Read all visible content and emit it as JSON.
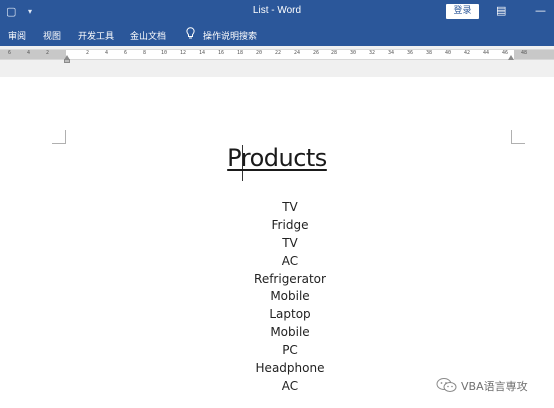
{
  "window": {
    "title": "List  -  Word",
    "login_label": "登录"
  },
  "menu": {
    "items": [
      {
        "label": "审阅"
      },
      {
        "label": "视图"
      },
      {
        "label": "开发工具"
      },
      {
        "label": "金山文档"
      }
    ],
    "tell_me_label": "操作说明搜索"
  },
  "ruler": {
    "left_numbers": [
      "6",
      "4",
      "2"
    ],
    "right_numbers": [
      "2",
      "4",
      "6",
      "8",
      "10",
      "12",
      "14",
      "16",
      "18",
      "20",
      "22",
      "24",
      "26",
      "28",
      "30",
      "32",
      "34",
      "36",
      "38",
      "40",
      "42",
      "44",
      "46",
      "48"
    ]
  },
  "document": {
    "title": "Products",
    "items": [
      "TV",
      "Fridge",
      "TV",
      "AC",
      "Refrigerator",
      "Mobile",
      "Laptop",
      "Mobile",
      "PC",
      "Headphone",
      "AC"
    ]
  },
  "watermark": {
    "text": "VBA语言専攻"
  },
  "colors": {
    "accent": "#2b579a"
  }
}
